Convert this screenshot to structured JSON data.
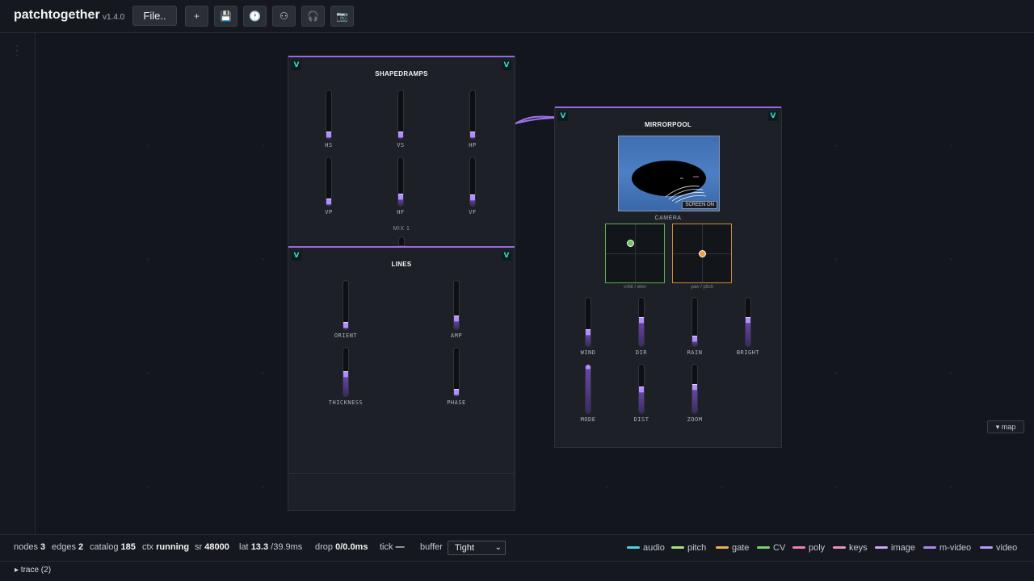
{
  "header": {
    "app_name": "patchtogether",
    "version": "v1.4.0",
    "file_label": "File..",
    "tools": [
      {
        "name": "add-icon",
        "glyph": "+"
      },
      {
        "name": "save-icon",
        "glyph": "💾"
      },
      {
        "name": "history-icon",
        "glyph": "🕐"
      },
      {
        "name": "link-icon",
        "glyph": "⚇"
      },
      {
        "name": "headphones-icon",
        "glyph": "🎧"
      },
      {
        "name": "camera-icon",
        "glyph": "📷"
      }
    ]
  },
  "panels": {
    "shapedramps": {
      "title": "SHAPEDRAMPS",
      "port_glyph": "V",
      "sliders": [
        {
          "label": "HS",
          "value": 0.0
        },
        {
          "label": "VS",
          "value": 0.0
        },
        {
          "label": "HP",
          "value": 0.0
        },
        {
          "label": "VP",
          "value": 0.0
        },
        {
          "label": "HF",
          "value": 0.12
        },
        {
          "label": "VF",
          "value": 0.1
        }
      ],
      "mix_label": "MIX 1"
    },
    "lines": {
      "title": "LINES",
      "port_glyph": "V",
      "sliders": [
        {
          "label": "ORIENT",
          "value": 0.0
        },
        {
          "label": "AMP",
          "value": 0.15
        },
        {
          "label": "THICKNESS",
          "value": 0.4
        },
        {
          "label": "PHASE",
          "value": 0.0
        }
      ]
    },
    "mirrorpool": {
      "title": "MIRRORPOOL",
      "port_glyph": "V",
      "screen_label": "SCREEN ON",
      "camera_label": "CAMERA",
      "pads": [
        {
          "label": "orbit / elev",
          "color": "#6cc45a"
        },
        {
          "label": "yaw / pitch",
          "color": "#f0a040"
        }
      ],
      "sliders": [
        {
          "label": "WIND",
          "value": 0.22
        },
        {
          "label": "DIR",
          "value": 0.5
        },
        {
          "label": "RAIN",
          "value": 0.08
        },
        {
          "label": "BRIGHT",
          "value": 0.5
        },
        {
          "label": "MODE",
          "value": 0.98
        },
        {
          "label": "DIST",
          "value": 0.45
        },
        {
          "label": "ZOOM",
          "value": 0.5
        }
      ]
    }
  },
  "map_label": "▾ map",
  "footer": {
    "stats": [
      {
        "label": "nodes",
        "value": "3"
      },
      {
        "label": "edges",
        "value": "2"
      },
      {
        "label": "catalog",
        "value": "185"
      },
      {
        "label": "ctx",
        "value": "running"
      },
      {
        "label": "sr",
        "value": "48000"
      },
      {
        "label": "lat",
        "value": "13.3",
        "suffix": "/39.9ms"
      },
      {
        "label": "drop",
        "value": "0/0.0ms"
      },
      {
        "label": "tick",
        "value": "—"
      }
    ],
    "buffer_label": "buffer",
    "buffer_value": "Tight",
    "legend": [
      {
        "label": "audio",
        "color": "#4fd1e0"
      },
      {
        "label": "pitch",
        "color": "#a8e07a"
      },
      {
        "label": "gate",
        "color": "#f0b050"
      },
      {
        "label": "CV",
        "color": "#7ad06a"
      },
      {
        "label": "poly",
        "color": "#f080b0"
      },
      {
        "label": "keys",
        "color": "#f090b8"
      },
      {
        "label": "image",
        "color": "#c9a8ff"
      },
      {
        "label": "m-video",
        "color": "#a888f0"
      },
      {
        "label": "video",
        "color": "#b898ff"
      }
    ],
    "trace_label": "▸ trace (2)"
  }
}
